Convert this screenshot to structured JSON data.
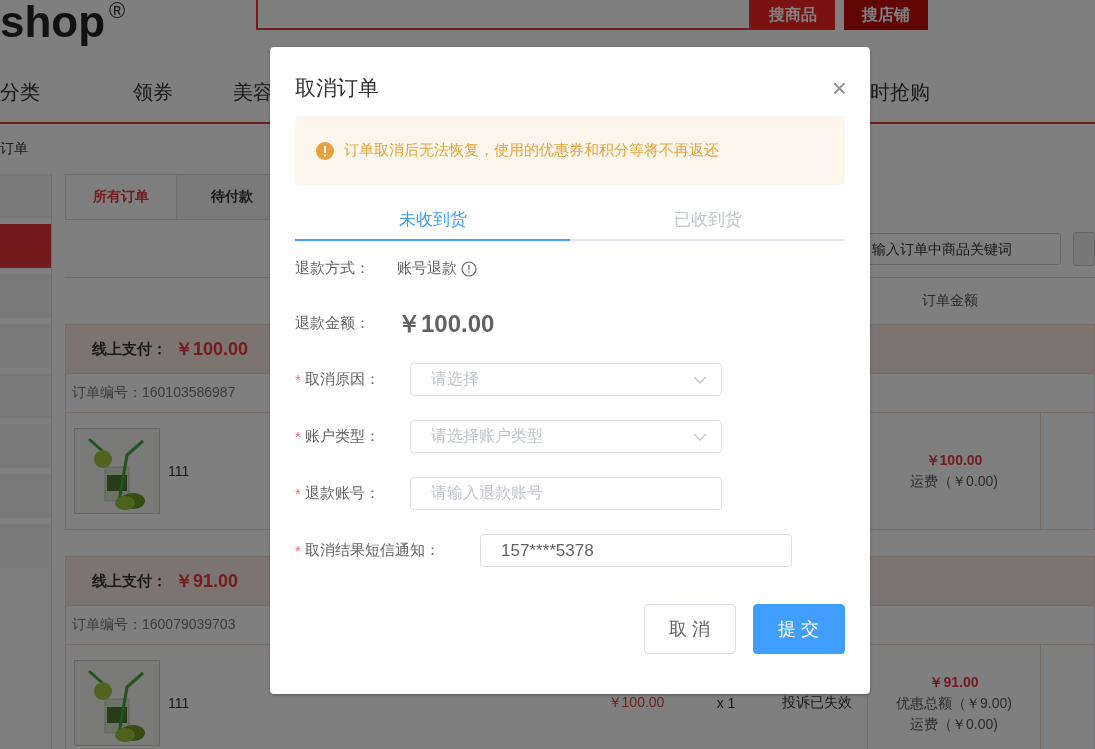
{
  "header": {
    "logo": "shop",
    "logo_mark": "®",
    "search_buttons": [
      {
        "label": "搜商品",
        "kind": "primary"
      },
      {
        "label": "搜店铺",
        "kind": "secondary"
      }
    ]
  },
  "nav": [
    "分类",
    "领券",
    "美容",
    "时抢购"
  ],
  "breadcrumb": "订单",
  "sidebar": {
    "items": [
      {
        "selected": false
      },
      {
        "selected": true
      },
      {
        "selected": false
      },
      {
        "selected": false
      },
      {
        "selected": false
      },
      {
        "selected": false
      },
      {
        "selected": false
      },
      {
        "selected": false
      }
    ]
  },
  "order_tabs": [
    {
      "label": "所有订单",
      "selected": true
    },
    {
      "label": "待付款",
      "selected": false
    }
  ],
  "order_search": {
    "placeholder": "输入订单中商品关键词"
  },
  "columns": [
    "订单金额"
  ],
  "orders": [
    {
      "payment_label": "线上支付：",
      "total": "￥100.00",
      "order_no": "订单编号：160103586987",
      "item": {
        "kind": "picture",
        "name": "111"
      },
      "amount": "￥100.00",
      "fees": [
        "运费（￥0.00)"
      ]
    },
    {
      "payment_label": "线上支付：",
      "total": "￥91.00",
      "order_no": "订单编号：160079039703",
      "item": {
        "kind": "picture",
        "name": "111"
      },
      "price": "￥100.00",
      "qty": "x 1",
      "status": "投诉已失效",
      "amount": "￥91.00",
      "fees": [
        "优惠总额（￥9.00)",
        "运费（￥0.00)"
      ]
    }
  ],
  "dialog": {
    "title": "取消订单",
    "close": "×",
    "alert": "订单取消后无法恢复，使用的优惠券和积分等将不再返还",
    "tabs": [
      {
        "label": "未收到货",
        "selected": true
      },
      {
        "label": "已收到货",
        "selected": false
      }
    ],
    "info": [
      {
        "label": "退款方式：",
        "value": "账号退款",
        "kind": "method"
      },
      {
        "label": "退款金额：",
        "value": "￥100.00",
        "kind": "amount"
      }
    ],
    "fields": [
      {
        "label": "取消原因：",
        "required_mark": "*",
        "kind": "select",
        "placeholder": "请选择"
      },
      {
        "label": "账户类型：",
        "required_mark": "*",
        "kind": "select",
        "placeholder": "请选择账户类型"
      },
      {
        "label": "退款账号：",
        "required_mark": "*",
        "kind": "input",
        "placeholder": "请输入退款账号"
      },
      {
        "label": "取消结果短信通知：",
        "required_mark": "*",
        "kind": "input",
        "value": "157****5378"
      }
    ],
    "buttons": [
      {
        "label": "取 消",
        "kind": "default"
      },
      {
        "label": "提 交",
        "kind": "primary"
      }
    ]
  }
}
